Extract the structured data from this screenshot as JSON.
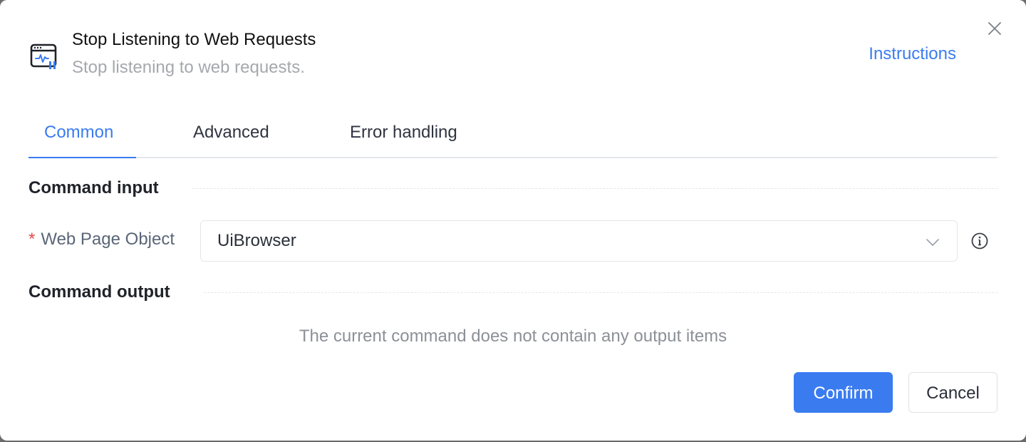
{
  "header": {
    "title": "Stop Listening to Web Requests",
    "subtitle": "Stop listening to web requests.",
    "instructions_link": "Instructions",
    "icon": "browser-monitor-pause-icon"
  },
  "tabs": [
    {
      "label": "Common",
      "active": true
    },
    {
      "label": "Advanced",
      "active": false
    },
    {
      "label": "Error handling",
      "active": false
    }
  ],
  "command_input": {
    "section_title": "Command input",
    "fields": [
      {
        "required_mark": "*",
        "label": "Web Page Object",
        "value": "UiBrowser",
        "control": "select"
      }
    ]
  },
  "command_output": {
    "section_title": "Command output",
    "empty_message": "The current command does not contain any output items"
  },
  "footer": {
    "confirm_label": "Confirm",
    "cancel_label": "Cancel"
  },
  "colors": {
    "accent": "#3a7cf0",
    "required": "#e5484d",
    "muted_text": "#a5a8ae"
  }
}
